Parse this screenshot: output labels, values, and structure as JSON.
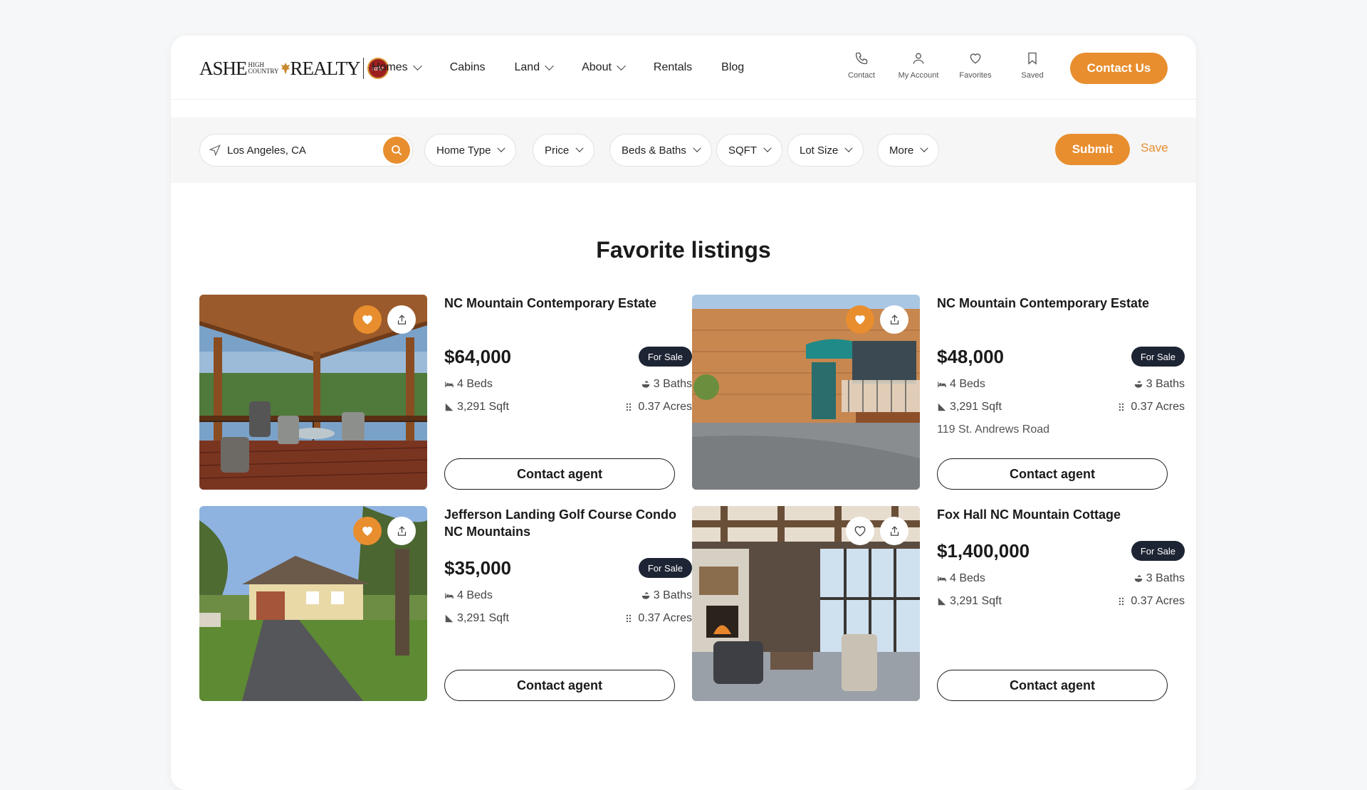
{
  "brand": {
    "logo_left": "ASHE",
    "logo_small_top": "HIGH",
    "logo_small_bottom": "COUNTRY",
    "logo_right": "REALTY",
    "logo_seal": "tate"
  },
  "nav": {
    "items": [
      {
        "label": "Homes",
        "dropdown": true
      },
      {
        "label": "Cabins",
        "dropdown": false
      },
      {
        "label": "Land",
        "dropdown": true
      },
      {
        "label": "About",
        "dropdown": true
      },
      {
        "label": "Rentals",
        "dropdown": false
      },
      {
        "label": "Blog",
        "dropdown": false
      }
    ],
    "icon_links": [
      {
        "label": "Contact",
        "icon": "phone-icon"
      },
      {
        "label": "My Account",
        "icon": "user-icon"
      },
      {
        "label": "Favorites",
        "icon": "heart-icon"
      },
      {
        "label": "Saved",
        "icon": "bookmark-icon"
      }
    ],
    "contact_button": "Contact Us"
  },
  "search": {
    "location_value": "Los Angeles, CA",
    "filters": [
      "Home Type",
      "Price",
      "Beds & Baths",
      "SQFT",
      "Lot Size",
      "More"
    ],
    "submit_label": "Submit",
    "save_label": "Save"
  },
  "page": {
    "title": "Favorite listings"
  },
  "listings": [
    {
      "title": "NC Mountain Contemporary Estate",
      "price": "$64,000",
      "status": "For Sale",
      "beds": "4 Beds",
      "baths": "3 Baths",
      "sqft": "3,291 Sqft",
      "acres": "0.37 Acres",
      "address": "",
      "favorited": true,
      "cta": "Contact agent",
      "photo": "covered porch with mountain view"
    },
    {
      "title": "NC Mountain Contemporary Estate",
      "price": "$48,000",
      "status": "For Sale",
      "beds": "4 Beds",
      "baths": "3 Baths",
      "sqft": "3,291 Sqft",
      "acres": "0.37 Acres",
      "address": "119 St. Andrews Road",
      "favorited": true,
      "cta": "Contact agent",
      "photo": "wooden house with teal awning"
    },
    {
      "title": "Jefferson Landing Golf Course Condo NC Mountains",
      "price": "$35,000",
      "status": "For Sale",
      "beds": "4 Beds",
      "baths": "3 Baths",
      "sqft": "3,291 Sqft",
      "acres": "0.37 Acres",
      "address": "",
      "favorited": true,
      "cta": "Contact agent",
      "photo": "ranch house with driveway"
    },
    {
      "title": "Fox Hall NC Mountain Cottage",
      "price": "$1,400,000",
      "status": "For Sale",
      "beds": "4 Beds",
      "baths": "3 Baths",
      "sqft": "3,291 Sqft",
      "acres": "0.37 Acres",
      "address": "",
      "favorited": false,
      "cta": "Contact agent",
      "photo": "living room with fireplace"
    }
  ],
  "colors": {
    "accent": "#e88e2e",
    "badge": "#1d2433",
    "text": "#1a1a1a"
  }
}
